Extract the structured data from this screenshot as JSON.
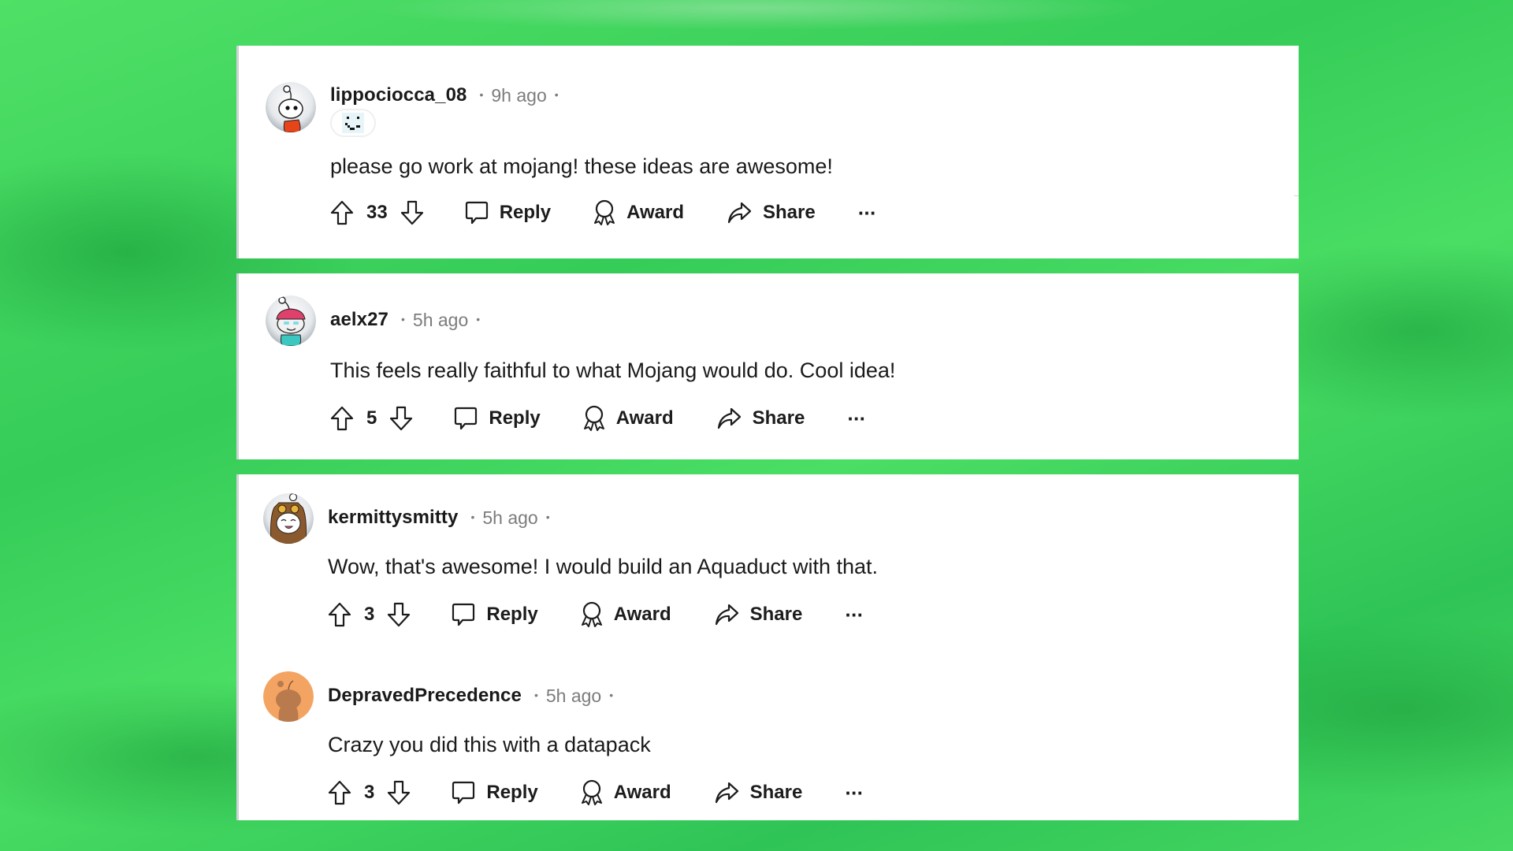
{
  "colors": {
    "background_green": "#3fd35e",
    "card": "#ffffff",
    "text_primary": "#1a1a1b",
    "text_meta": "#7c7c7c",
    "card_border": "#cfd3d6"
  },
  "comments": [
    {
      "username": "lippociocca_08",
      "time": "9h ago",
      "separator": "•",
      "flair_icon": "pixel-smiley-icon",
      "avatar_icon": "snoo-orange-hoodie-avatar",
      "text": "please go work at mojang! these ideas are awesome!",
      "score": "33",
      "actions": {
        "reply": "Reply",
        "award": "Award",
        "share": "Share",
        "more": "···"
      }
    },
    {
      "username": "aelx27",
      "time": "5h ago",
      "separator": "•",
      "avatar_icon": "snoo-pink-beanie-avatar",
      "text": "This feels really faithful to what Mojang would do. Cool idea!",
      "score": "5",
      "actions": {
        "reply": "Reply",
        "award": "Award",
        "share": "Share",
        "more": "···"
      }
    },
    {
      "username": "kermittysmitty",
      "time": "5h ago",
      "separator": "•",
      "avatar_icon": "snoo-owl-costume-avatar",
      "text": "Wow, that's awesome! I would build an Aquaduct with that.",
      "score": "3",
      "actions": {
        "reply": "Reply",
        "award": "Award",
        "share": "Share",
        "more": "···"
      }
    },
    {
      "username": "DepravedPrecedence",
      "time": "5h ago",
      "separator": "•",
      "avatar_icon": "snoo-default-orange-avatar",
      "text": "Crazy you did this with a datapack",
      "score": "3",
      "actions": {
        "reply": "Reply",
        "award": "Award",
        "share": "Share",
        "more": "···"
      }
    }
  ]
}
